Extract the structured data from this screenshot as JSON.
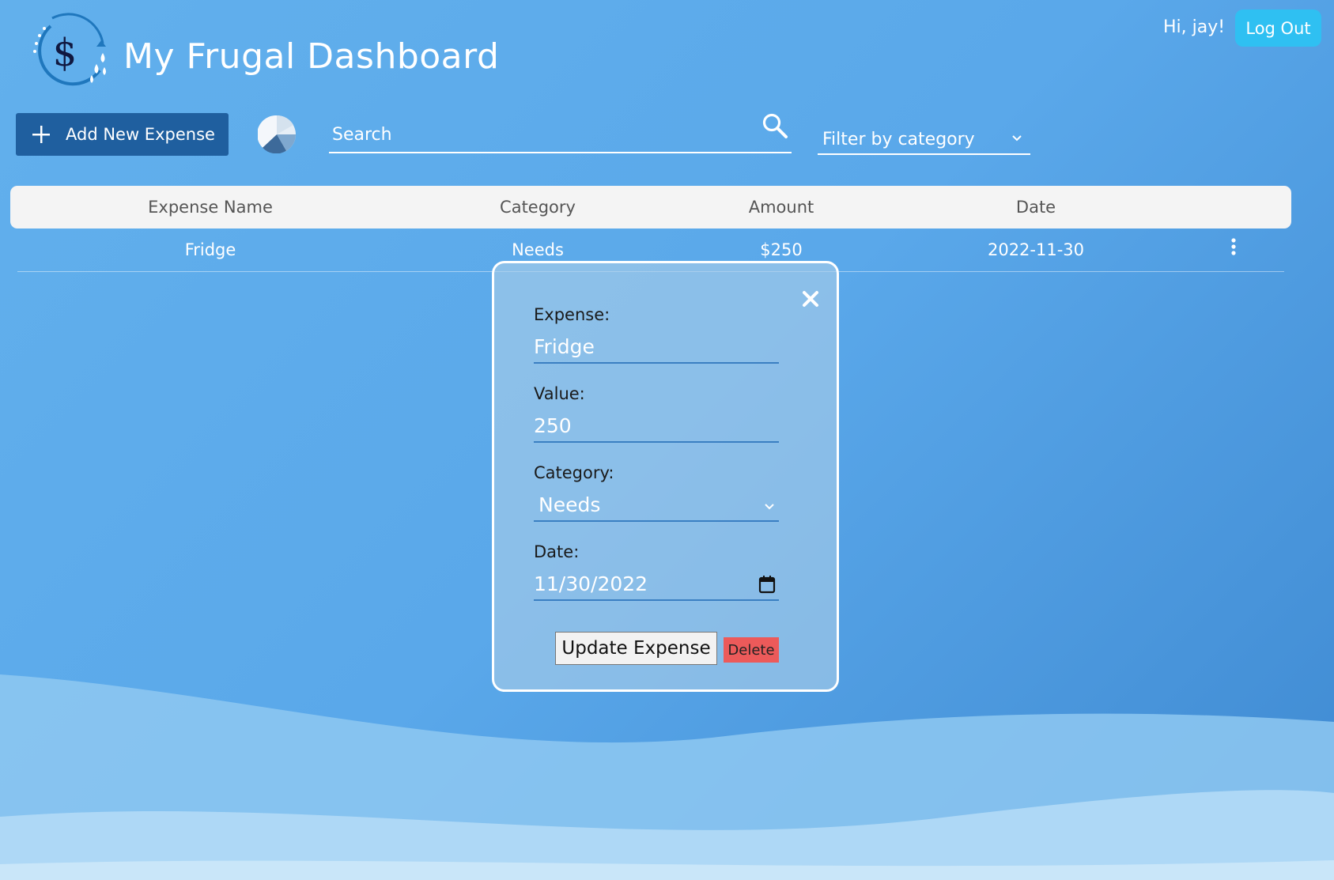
{
  "header": {
    "title": "My Frugal Dashboard",
    "greeting": "Hi, jay!",
    "logout_label": "Log Out",
    "logo_symbol": "$"
  },
  "toolbar": {
    "add_label": "Add New Expense",
    "search_placeholder": "Search",
    "filter_label": "Filter by category"
  },
  "table": {
    "columns": [
      "Expense Name",
      "Category",
      "Amount",
      "Date"
    ],
    "rows": [
      {
        "name": "Fridge",
        "category": "Needs",
        "amount": "$250",
        "date": "2022-11-30"
      }
    ]
  },
  "modal": {
    "expense_label": "Expense:",
    "expense_value": "Fridge",
    "value_label": "Value:",
    "value_value": "250",
    "category_label": "Category:",
    "category_value": "Needs",
    "date_label": "Date:",
    "date_value": "11/30/2022",
    "update_label": "Update Expense",
    "delete_label": "Delete"
  },
  "colors": {
    "accent": "#1f5f9f",
    "logout": "#2fc0f2",
    "delete": "#ec5a5a",
    "background": "#5aa8ea"
  },
  "icons": [
    "logo-icon",
    "plus-icon",
    "pie-chart-icon",
    "search-icon",
    "chevron-down-icon",
    "kebab-menu-icon",
    "close-icon",
    "calendar-icon"
  ]
}
